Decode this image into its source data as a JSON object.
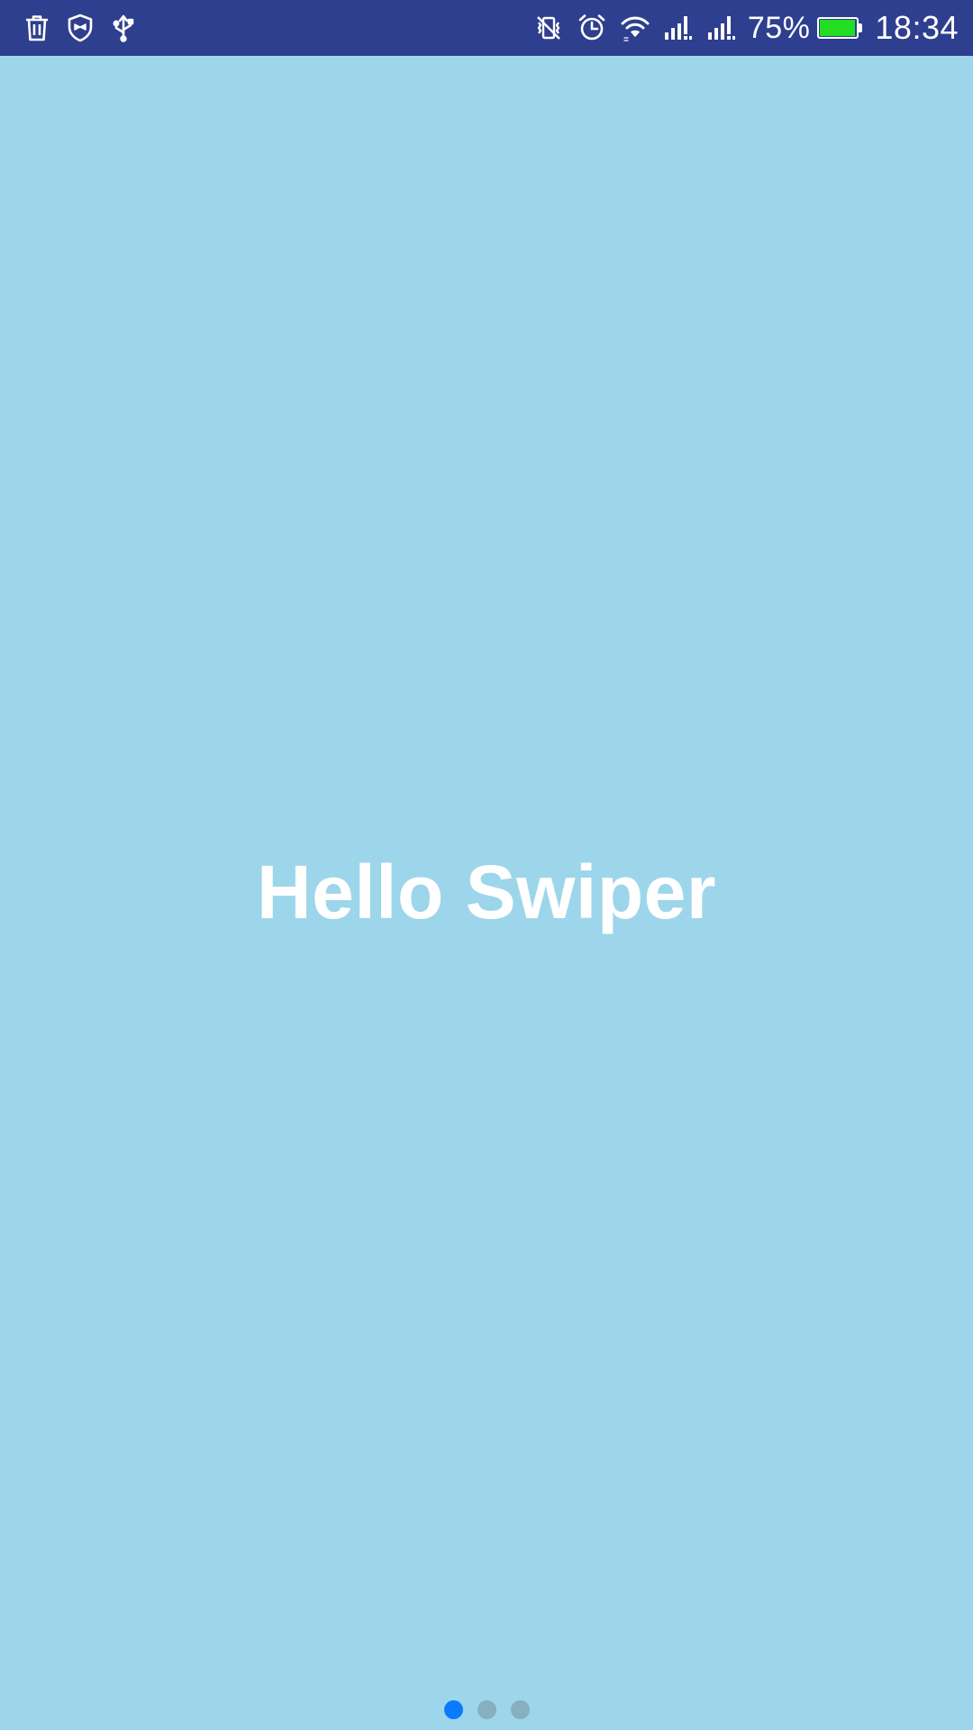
{
  "status_bar": {
    "background": "#2E3F8F",
    "left_icons": [
      "trash-icon",
      "shield-icon",
      "usb-icon"
    ],
    "right_icons": [
      "vibrate-off-icon",
      "alarm-icon",
      "wifi-icon",
      "signal-sim1-icon",
      "signal-sim2-icon"
    ],
    "battery_percent_text": "75%",
    "battery_level": 0.75,
    "battery_color": "#22DD22",
    "time": "18:34"
  },
  "slide": {
    "background": "#9DD6EA",
    "title": "Hello Swiper"
  },
  "pagination": {
    "count": 3,
    "active_index": 0,
    "active_color": "#0A7BFF",
    "inactive_color": "#86AFBF"
  }
}
